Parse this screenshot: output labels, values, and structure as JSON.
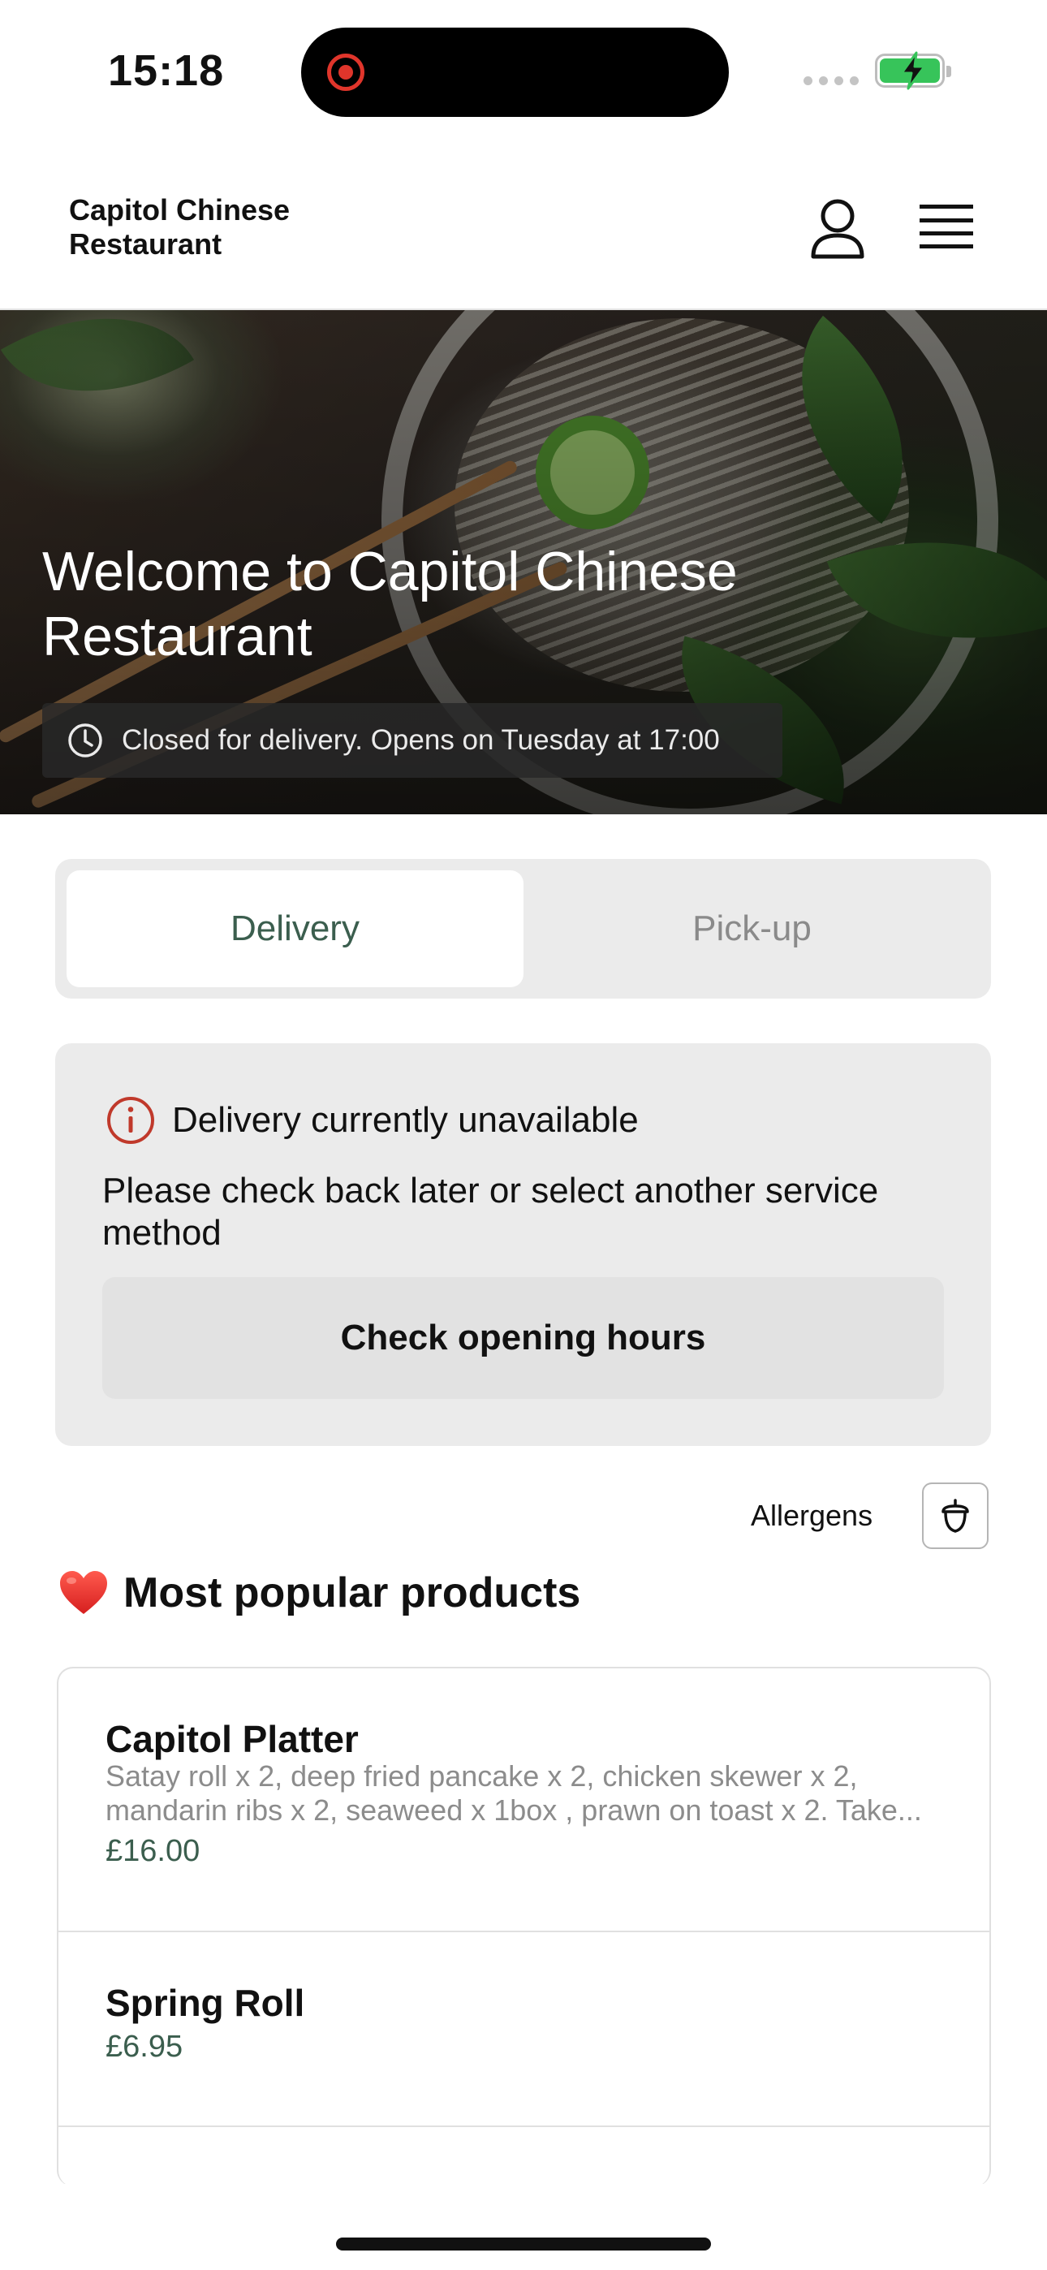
{
  "status_bar": {
    "time": "15:18"
  },
  "header": {
    "brand_line1": "Capitol Chinese",
    "brand_line2": "Restaurant"
  },
  "hero": {
    "title_line1": "Welcome to Capitol Chinese",
    "title_line2": "Restaurant",
    "hours_status": "Closed for delivery. Opens on Tuesday at 17:00"
  },
  "service_toggle": {
    "options": [
      {
        "label": "Delivery",
        "selected": true
      },
      {
        "label": "Pick-up",
        "selected": false
      }
    ]
  },
  "notice": {
    "title": "Delivery currently unavailable",
    "body_line1": "Please check back later or select another service",
    "body_line2": "method",
    "button_label": "Check opening hours"
  },
  "allergens": {
    "label": "Allergens"
  },
  "popular": {
    "title": "Most popular products",
    "products": [
      {
        "name": "Capitol Platter",
        "description_line1": "Satay roll x 2, deep fried pancake x 2, chicken skewer x 2,",
        "description_line2": "mandarin ribs x 2, seaweed x 1box , prawn on toast x 2. Take...",
        "price": "£16.00"
      },
      {
        "name": "Spring Roll",
        "price": "£6.95"
      }
    ]
  },
  "colors": {
    "accent_green": "#3b5e4e",
    "alert_red": "#c0392b",
    "battery_green": "#37c45a"
  },
  "icons": [
    "user-icon",
    "menu-icon",
    "clock-icon",
    "info-alert-icon",
    "acorn-allergen-icon",
    "heart-icon",
    "battery-charging-icon"
  ]
}
